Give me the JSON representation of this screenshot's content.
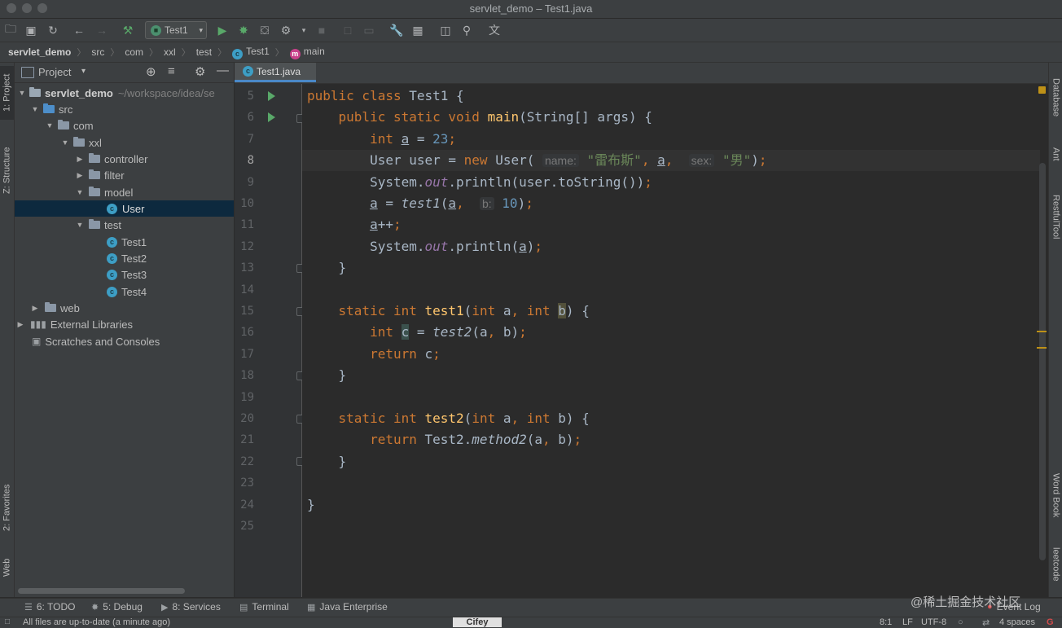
{
  "window": {
    "title": "servlet_demo – Test1.java"
  },
  "toolbar": {
    "run_config": "Test1"
  },
  "breadcrumb": [
    "servlet_demo",
    "src",
    "com",
    "xxl",
    "test",
    "Test1",
    "main"
  ],
  "left_strip": {
    "project": "1: Project",
    "structure": "Z: Structure",
    "favorites": "2: Favorites",
    "web": "Web"
  },
  "right_strip": {
    "database": "Database",
    "ant": "Ant",
    "restful": "RestfulTool",
    "wordbook": "Word Book",
    "leetcode": "leetcode"
  },
  "project": {
    "header": "Project",
    "tree": [
      {
        "label": "servlet_demo",
        "hint": "~/workspace/idea/se"
      },
      {
        "label": "src"
      },
      {
        "label": "com"
      },
      {
        "label": "xxl"
      },
      {
        "label": "controller"
      },
      {
        "label": "filter"
      },
      {
        "label": "model"
      },
      {
        "label": "User"
      },
      {
        "label": "test"
      },
      {
        "label": "Test1"
      },
      {
        "label": "Test2"
      },
      {
        "label": "Test3"
      },
      {
        "label": "Test4"
      },
      {
        "label": "web"
      },
      {
        "label": "External Libraries"
      },
      {
        "label": "Scratches and Consoles"
      }
    ]
  },
  "editor": {
    "tab": "Test1.java",
    "line_numbers": [
      "5",
      "6",
      "7",
      "8",
      "9",
      "10",
      "11",
      "12",
      "13",
      "14",
      "15",
      "16",
      "17",
      "18",
      "19",
      "20",
      "21",
      "22",
      "23",
      "24",
      "25"
    ],
    "hints": {
      "name": "name:",
      "sex": "sex:",
      "b": "b:"
    },
    "strings": {
      "name_value": "\"雷布斯\"",
      "sex_value": "\"男\""
    },
    "numbers": {
      "n23": "23",
      "n10": "10"
    }
  },
  "bottom_tabs": [
    {
      "label": "6: TODO"
    },
    {
      "label": "5: Debug"
    },
    {
      "label": "8: Services"
    },
    {
      "label": "Terminal"
    },
    {
      "label": "Java Enterprise"
    },
    {
      "label": "Event Log"
    }
  ],
  "status": {
    "message": "All files are up-to-date (a minute ago)",
    "center": "Cifey",
    "position": "8:1",
    "line_sep": "LF",
    "encoding": "UTF-8",
    "indent": "4 spaces"
  },
  "watermark": "@稀土掘金技术社区"
}
